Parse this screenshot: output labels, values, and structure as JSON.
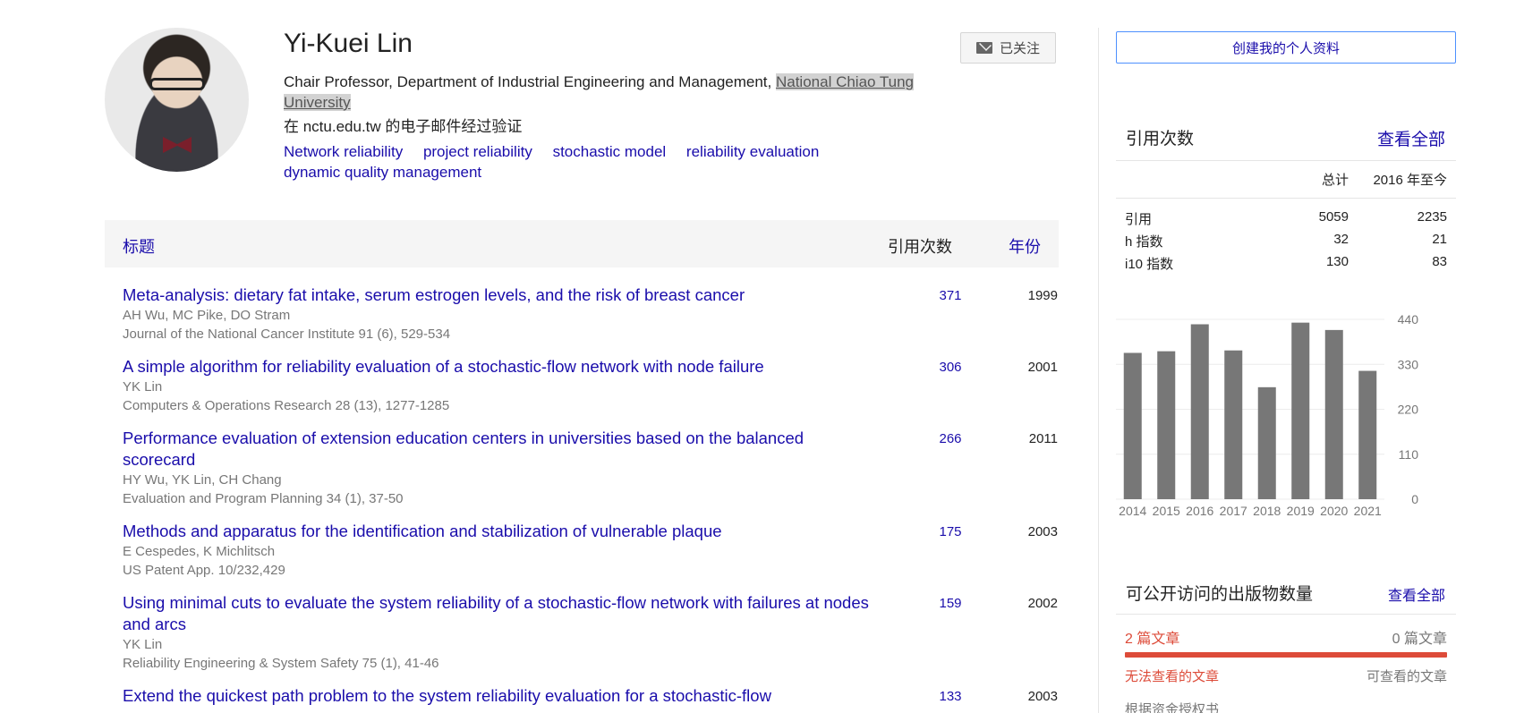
{
  "profile": {
    "name": "Yi-Kuei Lin",
    "follow_label": "已关注",
    "affiliation_prefix": "Chair Professor, Department of Industrial Engineering and Management, ",
    "affiliation_link": "National Chiao Tung University",
    "verified": "在 nctu.edu.tw 的电子邮件经过验证",
    "interests": [
      "Network reliability",
      "project reliability",
      "stochastic model",
      "reliability evaluation",
      "dynamic quality management"
    ]
  },
  "table": {
    "title_col": "标题",
    "cites_col": "引用次数",
    "year_col": "年份",
    "rows": [
      {
        "title": "Meta-analysis: dietary fat intake, serum estrogen levels, and the risk of breast cancer",
        "authors": "AH Wu, MC Pike, DO Stram",
        "venue": "Journal of the National Cancer Institute 91 (6), 529-534",
        "cites": "371",
        "year": "1999"
      },
      {
        "title": "A simple algorithm for reliability evaluation of a stochastic-flow network with node failure",
        "authors": "YK Lin",
        "venue": "Computers & Operations Research 28 (13), 1277-1285",
        "cites": "306",
        "year": "2001"
      },
      {
        "title": "Performance evaluation of extension education centers in universities based on the balanced scorecard",
        "authors": "HY Wu, YK Lin, CH Chang",
        "venue": "Evaluation and Program Planning 34 (1), 37-50",
        "cites": "266",
        "year": "2011"
      },
      {
        "title": "Methods and apparatus for the identification and stabilization of vulnerable plaque",
        "authors": "E Cespedes, K Michlitsch",
        "venue": "US Patent App. 10/232,429",
        "cites": "175",
        "year": "2003"
      },
      {
        "title": "Using minimal cuts to evaluate the system reliability of a stochastic-flow network with failures at nodes and arcs",
        "authors": "YK Lin",
        "venue": "Reliability Engineering & System Safety 75 (1), 41-46",
        "cites": "159",
        "year": "2002"
      },
      {
        "title": "Extend the quickest path problem to the system reliability evaluation for a stochastic-flow",
        "authors": "",
        "venue": "",
        "cites": "133",
        "year": "2003"
      }
    ]
  },
  "sidebar": {
    "create_profile": "创建我的个人资料",
    "cited_by_title": "引用次数",
    "see_all": "查看全部",
    "col_total": "总计",
    "col_since": "2016 年至今",
    "metrics": [
      {
        "label": "引用",
        "total": "5059",
        "since": "2235"
      },
      {
        "label": "h 指数",
        "total": "32",
        "since": "21"
      },
      {
        "label": "i10 指数",
        "total": "130",
        "since": "83"
      }
    ],
    "oa_title": "可公开访问的出版物数量",
    "oa_see_all": "查看全部",
    "oa_unavailable_count": "2 篇文章",
    "oa_available_count": "0 篇文章",
    "oa_unavailable_label": "无法查看的文章",
    "oa_available_label": "可查看的文章",
    "mandates": "根据资金授权书"
  },
  "colors": {
    "link": "#1a0dab",
    "bar": "#777777",
    "oa_red": "#dd4b39"
  },
  "chart_data": {
    "type": "bar",
    "categories": [
      "2014",
      "2015",
      "2016",
      "2017",
      "2018",
      "2019",
      "2020",
      "2021"
    ],
    "values": [
      358,
      362,
      428,
      364,
      274,
      432,
      414,
      314
    ],
    "yticks": [
      "0",
      "110",
      "220",
      "330",
      "440"
    ],
    "ylim": [
      0,
      440
    ],
    "grid": true
  }
}
